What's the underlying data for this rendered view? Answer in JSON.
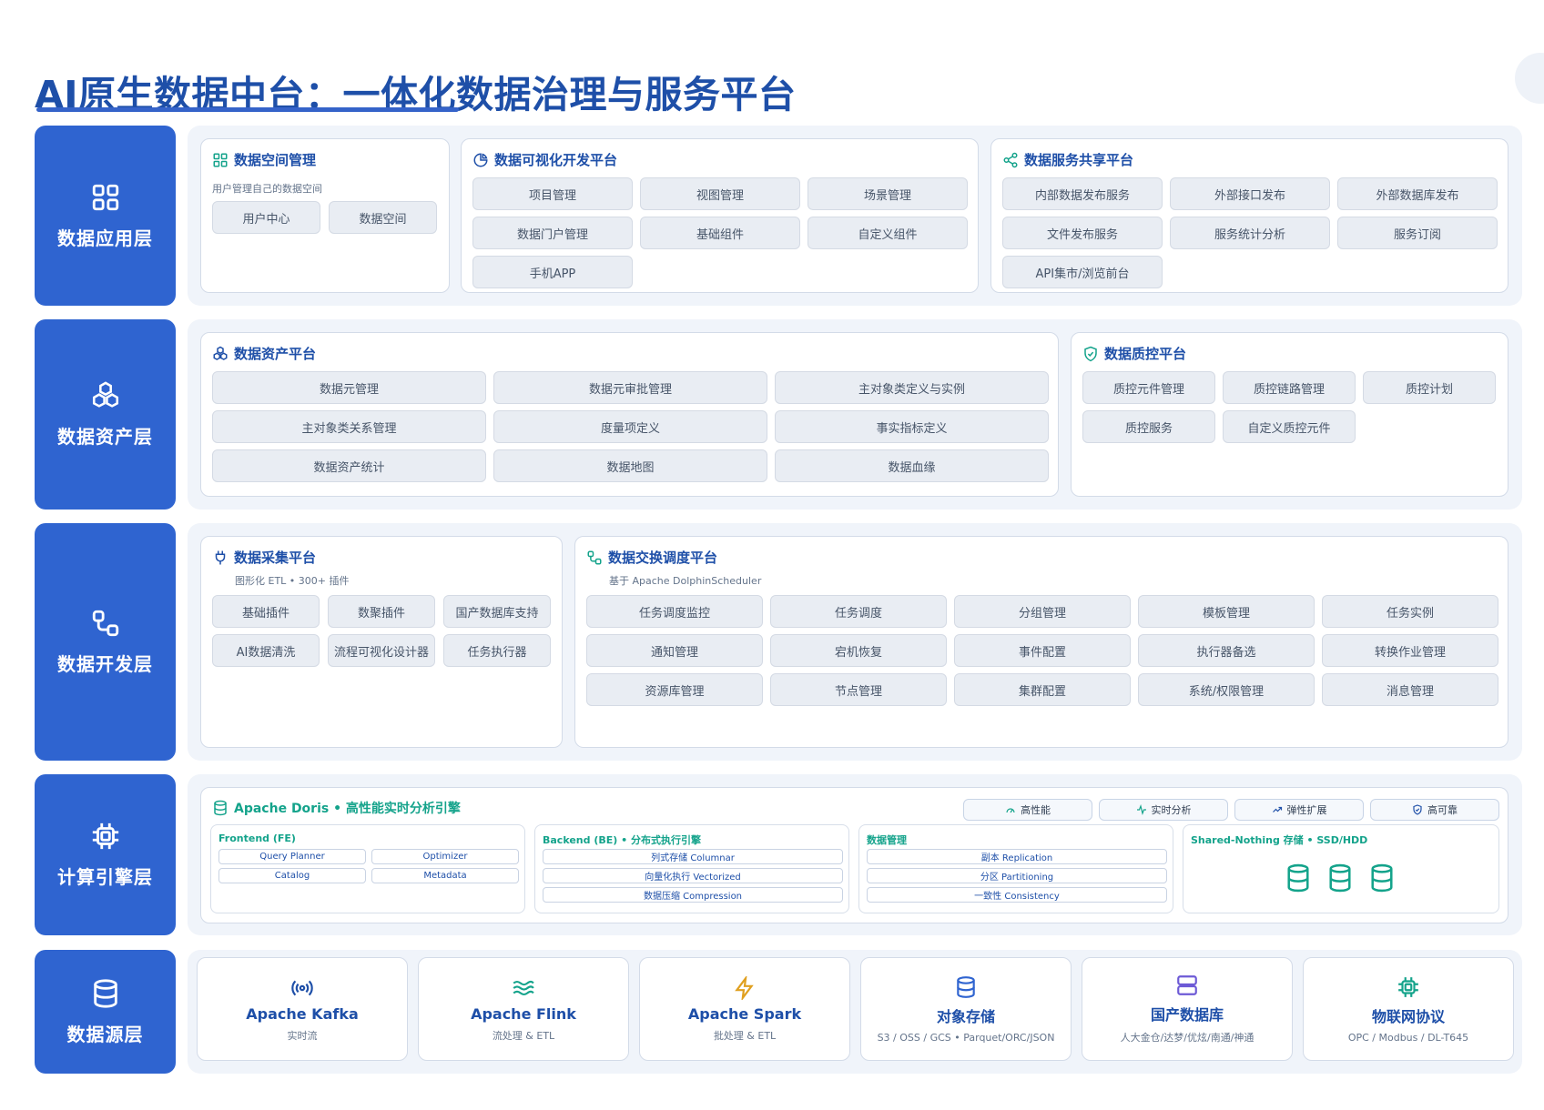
{
  "title": "AI原生数据中台：一体化数据治理与服务平台",
  "layers": {
    "app": "数据应用层",
    "asset": "数据资产层",
    "dev": "数据开发层",
    "engine": "计算引擎层",
    "source": "数据源层"
  },
  "app_layer": {
    "space": {
      "title": "数据空间管理",
      "subtitle": "用户管理自己的数据空间",
      "items": [
        "用户中心",
        "数据空间"
      ]
    },
    "visual": {
      "title": "数据可视化开发平台",
      "items": [
        "项目管理",
        "视图管理",
        "场景管理",
        "数据门户管理",
        "基础组件",
        "自定义组件",
        "手机APP"
      ]
    },
    "share": {
      "title": "数据服务共享平台",
      "items": [
        "内部数据发布服务",
        "外部接口发布",
        "外部数据库发布",
        "文件发布服务",
        "服务统计分析",
        "服务订阅",
        "API集市/浏览前台"
      ]
    }
  },
  "asset_layer": {
    "asset": {
      "title": "数据资产平台",
      "items": [
        "数据元管理",
        "数据元审批管理",
        "主对象类定义与实例",
        "主对象类关系管理",
        "度量项定义",
        "事实指标定义",
        "数据资产统计",
        "数据地图",
        "数据血缘"
      ]
    },
    "quality": {
      "title": "数据质控平台",
      "items": [
        "质控元件管理",
        "质控链路管理",
        "质控计划",
        "质控服务",
        "自定义质控元件"
      ]
    }
  },
  "dev_layer": {
    "collect": {
      "title": "数据采集平台",
      "subtitle": "图形化 ETL • 300+ 插件",
      "items": [
        "基础插件",
        "数聚插件",
        "国产数据库支持",
        "AI数据清洗",
        "流程可视化设计器",
        "任务执行器"
      ]
    },
    "exchange": {
      "title": "数据交换调度平台",
      "subtitle": "基于 Apache DolphinScheduler",
      "items": [
        "任务调度监控",
        "任务调度",
        "分组管理",
        "模板管理",
        "任务实例",
        "通知管理",
        "宕机恢复",
        "事件配置",
        "执行器备选",
        "转换作业管理",
        "资源库管理",
        "节点管理",
        "集群配置",
        "系统/权限管理",
        "消息管理"
      ]
    }
  },
  "engine_layer": {
    "title": "Apache Doris • 高性能实时分析引擎",
    "badges": [
      "高性能",
      "实时分析",
      "弹性扩展",
      "高可靠"
    ],
    "fe": {
      "title": "Frontend (FE)",
      "items": [
        "Query Planner",
        "Optimizer",
        "Catalog",
        "Metadata"
      ]
    },
    "be": {
      "title": "Backend (BE) • 分布式执行引擎",
      "items": [
        "列式存储 Columnar",
        "向量化执行 Vectorized",
        "数据压缩 Compression"
      ]
    },
    "dm": {
      "title": "数据管理",
      "items": [
        "副本 Replication",
        "分区 Partitioning",
        "一致性 Consistency"
      ]
    },
    "storage": {
      "title": "Shared-Nothing 存储 • SSD/HDD"
    }
  },
  "source_layer": [
    {
      "name": "Apache Kafka",
      "desc": "实时流",
      "icon": "broadcast-icon",
      "color": "#1e4fa8"
    },
    {
      "name": "Apache Flink",
      "desc": "流处理 & ETL",
      "icon": "waves-icon",
      "color": "#14a38b"
    },
    {
      "name": "Apache Spark",
      "desc": "批处理 & ETL",
      "icon": "lightning-icon",
      "color": "#e0a020"
    },
    {
      "name": "对象存储",
      "desc": "S3 / OSS / GCS • Parquet/ORC/JSON",
      "icon": "database-icon",
      "color": "#2f64d0"
    },
    {
      "name": "国产数据库",
      "desc": "人大金仓/达梦/优炫/南通/神通",
      "icon": "server-icon",
      "color": "#6d5ad6"
    },
    {
      "name": "物联网协议",
      "desc": "OPC / Modbus / DL-T645",
      "icon": "chip-icon",
      "color": "#14a38b"
    }
  ],
  "colors": {
    "primary": "#2f64d0",
    "title": "#1e4fa8",
    "teal": "#14a38b",
    "layer_bg": "#f0f4fa",
    "chip_bg": "#e9edf3"
  }
}
